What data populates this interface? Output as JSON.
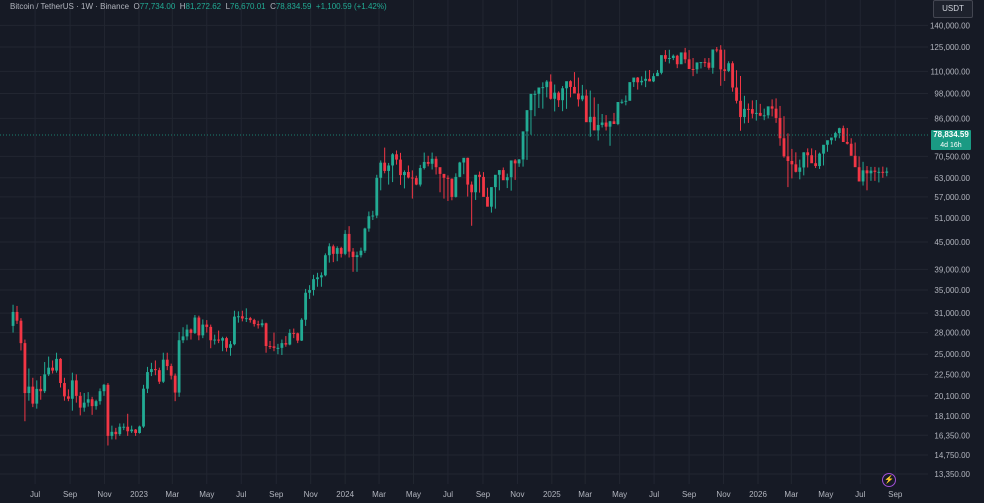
{
  "legend": {
    "symbol": "Bitcoin / TetherUS · 1W · Binance",
    "o_label": "O",
    "o_value": "77,734.00",
    "h_label": "H",
    "h_value": "81,272.62",
    "l_label": "L",
    "l_value": "76,670.01",
    "c_label": "C",
    "c_value": "78,834.59",
    "change": "+1,100.59 (+1.42%)"
  },
  "currency": "USDT",
  "last_price": {
    "price": "78,834.59",
    "countdown": "4d 16h"
  },
  "colors": {
    "up": "#22ab94",
    "down": "#f23645",
    "background": "#161a25",
    "grid": "#222631",
    "text": "#b2b5be"
  },
  "icons": [
    "lightning-icon"
  ],
  "chart_data": {
    "type": "candlestick",
    "scale": "log",
    "y_ticks": [
      140000,
      125000,
      110000,
      98000,
      86000,
      70500,
      63000,
      57000,
      51000,
      45000,
      39000,
      35000,
      31000,
      28000,
      25000,
      22500,
      20100,
      18100,
      16350,
      14750,
      13350
    ],
    "y_tick_labels": [
      "140,000.00",
      "125,000.00",
      "110,000.00",
      "98,000.00",
      "86,000.00",
      "70,500.00",
      "63,000.00",
      "57,000.00",
      "51,000.00",
      "45,000.00",
      "39,000.00",
      "35,000.00",
      "31,000.00",
      "28,000.00",
      "25,000.00",
      "22,500.00",
      "20,100.00",
      "18,100.00",
      "16,350.00",
      "14,750.00",
      "13,350.00"
    ],
    "x_ticks": [
      {
        "label": "Jul",
        "date": "2022-07-01"
      },
      {
        "label": "Sep",
        "date": "2022-09-01"
      },
      {
        "label": "Nov",
        "date": "2022-11-01"
      },
      {
        "label": "2023",
        "date": "2023-01-01"
      },
      {
        "label": "Mar",
        "date": "2023-03-01"
      },
      {
        "label": "May",
        "date": "2023-05-01"
      },
      {
        "label": "Jul",
        "date": "2023-07-01"
      },
      {
        "label": "Sep",
        "date": "2023-09-01"
      },
      {
        "label": "Nov",
        "date": "2023-11-01"
      },
      {
        "label": "2024",
        "date": "2024-01-01"
      },
      {
        "label": "Mar",
        "date": "2024-03-01"
      },
      {
        "label": "May",
        "date": "2024-05-01"
      },
      {
        "label": "Jul",
        "date": "2024-07-01"
      },
      {
        "label": "Sep",
        "date": "2024-09-01"
      },
      {
        "label": "Nov",
        "date": "2024-11-01"
      },
      {
        "label": "2025",
        "date": "2025-01-01"
      },
      {
        "label": "Mar",
        "date": "2025-03-01"
      },
      {
        "label": "May",
        "date": "2025-05-01"
      },
      {
        "label": "Jul",
        "date": "2025-07-01"
      },
      {
        "label": "Sep",
        "date": "2025-09-01"
      },
      {
        "label": "Nov",
        "date": "2025-11-01"
      },
      {
        "label": "2026",
        "date": "2026-01-01"
      },
      {
        "label": "Mar",
        "date": "2026-03-01"
      },
      {
        "label": "May",
        "date": "2026-05-01"
      },
      {
        "label": "Jul",
        "date": "2026-07-01"
      },
      {
        "label": "Sep",
        "date": "2026-09-01"
      }
    ],
    "candle_dates": [
      "2022-05-23",
      "2022-05-30",
      "2022-06-06",
      "2022-06-13",
      "2022-06-20",
      "2022-06-27",
      "2022-07-04",
      "2022-07-11",
      "2022-07-18",
      "2022-07-25",
      "2022-08-01",
      "2022-08-08",
      "2022-08-15",
      "2022-08-22",
      "2022-08-29",
      "2022-09-05",
      "2022-09-12",
      "2022-09-19",
      "2022-09-26",
      "2022-10-03",
      "2022-10-10",
      "2022-10-17",
      "2022-10-24",
      "2022-10-31",
      "2022-11-07",
      "2022-11-14",
      "2022-11-21",
      "2022-11-28",
      "2022-12-05",
      "2022-12-12",
      "2022-12-19",
      "2022-12-26",
      "2023-01-02",
      "2023-01-09",
      "2023-01-16",
      "2023-01-23",
      "2023-01-30",
      "2023-02-06",
      "2023-02-13",
      "2023-02-20",
      "2023-02-27",
      "2023-03-06",
      "2023-03-13",
      "2023-03-20",
      "2023-03-27",
      "2023-04-03",
      "2023-04-10",
      "2023-04-17",
      "2023-04-24",
      "2023-05-01",
      "2023-05-08",
      "2023-05-15",
      "2023-05-22",
      "2023-05-29",
      "2023-06-05",
      "2023-06-12",
      "2023-06-19",
      "2023-06-26",
      "2023-07-03",
      "2023-07-10",
      "2023-07-17",
      "2023-07-24",
      "2023-07-31",
      "2023-08-07",
      "2023-08-14",
      "2023-08-21",
      "2023-08-28",
      "2023-09-04",
      "2023-09-11",
      "2023-09-18",
      "2023-09-25",
      "2023-10-02",
      "2023-10-09",
      "2023-10-16",
      "2023-10-23",
      "2023-10-30",
      "2023-11-06",
      "2023-11-13",
      "2023-11-20",
      "2023-11-27",
      "2023-12-04",
      "2023-12-11",
      "2023-12-18",
      "2023-12-25",
      "2024-01-01",
      "2024-01-08",
      "2024-01-15",
      "2024-01-22",
      "2024-01-29",
      "2024-02-05",
      "2024-02-12",
      "2024-02-19",
      "2024-02-26",
      "2024-03-04",
      "2024-03-11",
      "2024-03-18",
      "2024-03-25",
      "2024-04-01",
      "2024-04-08",
      "2024-04-15",
      "2024-04-22",
      "2024-04-29",
      "2024-05-06",
      "2024-05-13",
      "2024-05-20",
      "2024-05-27",
      "2024-06-03",
      "2024-06-10",
      "2024-06-17",
      "2024-06-24",
      "2024-07-01",
      "2024-07-08",
      "2024-07-15",
      "2024-07-22",
      "2024-07-29",
      "2024-08-05",
      "2024-08-12",
      "2024-08-19",
      "2024-08-26",
      "2024-09-02",
      "2024-09-09",
      "2024-09-16",
      "2024-09-23",
      "2024-09-30",
      "2024-10-07",
      "2024-10-14",
      "2024-10-21",
      "2024-10-28",
      "2024-11-04",
      "2024-11-11",
      "2024-11-18",
      "2024-11-25",
      "2024-12-02",
      "2024-12-09",
      "2024-12-16",
      "2024-12-23",
      "2024-12-30",
      "2025-01-06",
      "2025-01-13",
      "2025-01-20",
      "2025-01-27",
      "2025-02-03",
      "2025-02-10",
      "2025-02-17",
      "2025-02-24",
      "2025-03-03",
      "2025-03-10",
      "2025-03-17",
      "2025-03-24",
      "2025-03-31",
      "2025-04-07",
      "2025-04-14",
      "2025-04-21",
      "2025-04-28",
      "2025-05-05",
      "2025-05-12",
      "2025-05-19",
      "2025-05-26",
      "2025-06-02",
      "2025-06-09",
      "2025-06-16",
      "2025-06-23",
      "2025-06-30",
      "2025-07-07",
      "2025-07-14",
      "2025-07-21",
      "2025-07-28",
      "2025-08-04",
      "2025-08-11",
      "2025-08-18",
      "2025-08-25",
      "2025-09-01",
      "2025-09-08",
      "2025-09-15",
      "2025-09-22",
      "2025-09-29",
      "2025-10-06",
      "2025-10-13",
      "2025-10-20",
      "2025-10-27",
      "2025-11-03",
      "2025-11-10",
      "2025-11-17",
      "2025-11-24",
      "2025-12-01",
      "2025-12-08",
      "2025-12-15",
      "2025-12-22",
      "2025-12-29",
      "2026-01-05",
      "2026-01-12",
      "2026-01-19",
      "2026-01-26",
      "2026-02-02",
      "2026-02-09",
      "2026-02-16",
      "2026-02-23",
      "2026-03-02",
      "2026-03-09",
      "2026-03-16",
      "2026-03-23",
      "2026-03-30",
      "2026-04-06",
      "2026-04-13",
      "2026-04-20",
      "2026-04-27",
      "2026-05-04",
      "2026-05-11",
      "2026-05-18",
      "2026-05-25",
      "2026-06-01",
      "2026-06-08",
      "2026-06-15",
      "2026-06-22",
      "2026-06-29",
      "2026-07-06",
      "2026-07-13",
      "2026-07-20",
      "2026-07-27",
      "2026-08-03",
      "2026-08-10",
      "2026-08-17"
    ],
    "open": [
      29000,
      31200,
      29800,
      26500,
      20400,
      21100,
      19300,
      20850,
      20600,
      22500,
      23300,
      22950,
      24400,
      21500,
      20050,
      19800,
      21800,
      20100,
      18900,
      19400,
      19750,
      19050,
      19550,
      20600,
      21300,
      16300,
      16650,
      16450,
      17100,
      17100,
      16700,
      16850,
      16550,
      17120,
      20870,
      22770,
      23130,
      23000,
      21650,
      24300,
      23500,
      22350,
      20450,
      26900,
      27450,
      28450,
      27950,
      30300,
      27600,
      29200,
      28850,
      26900,
      27000,
      26850,
      27200,
      25850,
      26350,
      30450,
      30500,
      30150,
      30200,
      29900,
      29280,
      29100,
      29400,
      26100,
      26050,
      25850,
      25850,
      26500,
      26300,
      27950,
      27900,
      26850,
      29950,
      34500,
      35000,
      37050,
      37400,
      37800,
      42000,
      44000,
      42300,
      43600,
      42300,
      46950,
      42800,
      41600,
      42000,
      43000,
      48300,
      51500,
      51700,
      63000,
      68200,
      65300,
      67200,
      71250,
      69300,
      63900,
      64950,
      63100,
      62900,
      60800,
      66300,
      68450,
      67800,
      69600,
      66600,
      64300,
      63000,
      62700,
      57000,
      63300,
      68250,
      69950,
      60800,
      58400,
      64000,
      63300,
      57000,
      54150,
      60000,
      64000,
      65600,
      62200,
      63200,
      69000,
      67950,
      69350,
      80350,
      89800,
      97800,
      97800,
      101100,
      101300,
      104300,
      95300,
      98400,
      94600,
      100700,
      104500,
      101400,
      98000,
      95000,
      96900,
      84300,
      86700,
      80750,
      83100,
      84150,
      82350,
      84700,
      83500,
      93700,
      93800,
      94300,
      104000,
      106500,
      103900,
      104700,
      105800,
      104400,
      107300,
      109200,
      119800,
      117500,
      118000,
      119400,
      114200,
      121500,
      117200,
      111400,
      111200,
      115300,
      115500,
      115200,
      112100,
      123400,
      123250,
      111200,
      110300,
      114800,
      101100,
      94300,
      86600,
      90400,
      90300,
      88150,
      88500,
      87200,
      87400,
      91600,
      90500,
      86200,
      77500,
      70500,
      68800,
      67600,
      65000,
      66500,
      72000,
      70900,
      68000,
      67000,
      71500,
      74900,
      76700,
      77800,
      79600,
      81700,
      76000,
      75300,
      70700,
      66600,
      61800,
      65500,
      64500,
      65400,
      65000,
      65000,
      64700,
      65100,
      77734
    ],
    "close": [
      31200,
      29800,
      26500,
      20400,
      21100,
      19300,
      20850,
      20600,
      22500,
      23300,
      22950,
      24400,
      21500,
      20050,
      19800,
      21800,
      20100,
      18900,
      19400,
      19750,
      19050,
      19550,
      20600,
      21300,
      16300,
      16650,
      16450,
      17100,
      17100,
      16700,
      16850,
      16550,
      17120,
      20870,
      22770,
      23130,
      23000,
      21650,
      24300,
      23500,
      22350,
      20450,
      26900,
      27450,
      28450,
      27950,
      30300,
      27600,
      29200,
      28850,
      26900,
      27000,
      26850,
      27200,
      25850,
      26350,
      30450,
      30500,
      30150,
      30200,
      29900,
      29280,
      29100,
      29400,
      26100,
      26050,
      25850,
      25850,
      26500,
      26300,
      27950,
      27900,
      26850,
      29950,
      34500,
      35000,
      37050,
      37400,
      37800,
      42000,
      44000,
      42300,
      43600,
      42300,
      46950,
      42800,
      41600,
      42000,
      43000,
      48300,
      51500,
      51700,
      63000,
      68200,
      65300,
      67200,
      71250,
      69300,
      63900,
      64950,
      63100,
      62900,
      60800,
      66300,
      68450,
      67800,
      69600,
      66600,
      64300,
      63000,
      62700,
      57000,
      63300,
      68250,
      69950,
      60800,
      58400,
      64000,
      63300,
      57000,
      54150,
      60000,
      64000,
      65600,
      62200,
      63200,
      69000,
      67950,
      69350,
      80350,
      89800,
      97800,
      97800,
      101100,
      101300,
      104300,
      95300,
      98400,
      94600,
      100700,
      104500,
      101400,
      98000,
      95000,
      96900,
      84300,
      86700,
      80750,
      83100,
      84150,
      82350,
      84700,
      83500,
      93700,
      93800,
      94300,
      104000,
      106500,
      103900,
      104700,
      105800,
      104400,
      107300,
      109200,
      119800,
      117500,
      118000,
      119400,
      114200,
      121500,
      117200,
      111400,
      111200,
      115300,
      115500,
      115200,
      112100,
      123400,
      123250,
      111200,
      110300,
      114800,
      101100,
      94300,
      86600,
      90400,
      90300,
      88150,
      88500,
      87200,
      87400,
      91600,
      90500,
      86200,
      77500,
      70500,
      68800,
      67600,
      65000,
      66500,
      72000,
      70900,
      68000,
      67000,
      71500,
      74900,
      76700,
      77800,
      79600,
      81700,
      76000,
      75300,
      70700,
      66600,
      61800,
      65500,
      64500,
      65400,
      65000,
      65000,
      64700,
      65100,
      77734,
      78835
    ],
    "high": [
      32400,
      32200,
      30200,
      27000,
      23200,
      22100,
      21800,
      22300,
      24000,
      24700,
      24200,
      25200,
      24500,
      22100,
      20800,
      22700,
      22500,
      20500,
      20400,
      20500,
      20000,
      19700,
      20900,
      21400,
      21500,
      17200,
      17000,
      17400,
      17400,
      18300,
      17200,
      16900,
      17200,
      21300,
      23400,
      23900,
      24200,
      23300,
      25200,
      25200,
      23800,
      22600,
      28100,
      28800,
      29200,
      28600,
      30700,
      30600,
      30000,
      29900,
      29200,
      27700,
      28300,
      27400,
      27400,
      26800,
      31400,
      31300,
      31400,
      31800,
      30400,
      30100,
      29800,
      30000,
      29500,
      26800,
      28000,
      26400,
      27000,
      27500,
      28500,
      28600,
      28000,
      30200,
      35200,
      35900,
      37900,
      38300,
      38400,
      42400,
      44700,
      44400,
      44000,
      43900,
      47900,
      48900,
      43600,
      42800,
      43700,
      48500,
      52800,
      53000,
      64000,
      69000,
      73800,
      68100,
      71700,
      72700,
      71800,
      65500,
      67200,
      65500,
      63700,
      67400,
      71900,
      70700,
      71900,
      70500,
      66500,
      64300,
      63800,
      62800,
      64500,
      68500,
      69900,
      70000,
      61800,
      62500,
      65100,
      64900,
      59800,
      59300,
      60700,
      64800,
      66500,
      64400,
      64000,
      69500,
      69500,
      70200,
      81800,
      93400,
      99500,
      99800,
      103900,
      105100,
      108300,
      102700,
      99100,
      101900,
      102800,
      105000,
      109600,
      106500,
      102500,
      100000,
      99500,
      96000,
      92800,
      88000,
      87500,
      84900,
      88500,
      88700,
      95000,
      97000,
      97900,
      104600,
      106800,
      107200,
      110400,
      110800,
      108900,
      110800,
      112000,
      123000,
      123200,
      120200,
      120000,
      119500,
      124400,
      123000,
      118000,
      113500,
      115500,
      117900,
      118000,
      116300,
      125000,
      126200,
      123300,
      116000,
      116000,
      110700,
      107400,
      96800,
      93000,
      94500,
      94700,
      92800,
      90500,
      90500,
      95000,
      95500,
      91800,
      87000,
      79500,
      73300,
      72000,
      69300,
      72000,
      73500,
      73500,
      72800,
      71900,
      74500,
      75700,
      77200,
      80200,
      81900,
      82800,
      81800,
      77500,
      75800,
      70500,
      68500,
      67000,
      66700,
      66700,
      66500,
      66800,
      66500,
      66000,
      78800,
      81272.62
    ],
    "low": [
      28000,
      29300,
      25500,
      17600,
      19600,
      18950,
      18800,
      19700,
      20400,
      22300,
      22600,
      22700,
      21000,
      19600,
      19550,
      18600,
      19400,
      18150,
      18500,
      19000,
      18200,
      18700,
      19200,
      20100,
      15500,
      16000,
      16000,
      16300,
      16800,
      16300,
      16550,
      16300,
      16500,
      17000,
      20400,
      22300,
      22400,
      21400,
      21500,
      23000,
      21900,
      19550,
      20000,
      26500,
      26900,
      27000,
      27800,
      26900,
      27200,
      28000,
      25800,
      26300,
      26500,
      25400,
      25350,
      24800,
      26200,
      29500,
      29700,
      29600,
      29500,
      28900,
      28600,
      28800,
      25200,
      25700,
      25400,
      25000,
      24900,
      26000,
      26200,
      27200,
      26500,
      26800,
      29000,
      33400,
      34000,
      35600,
      35600,
      37600,
      40400,
      40500,
      40700,
      41500,
      42000,
      41500,
      38500,
      38500,
      41500,
      42500,
      47500,
      50500,
      51000,
      59000,
      64500,
      60800,
      61600,
      67500,
      60700,
      59600,
      62800,
      56500,
      60600,
      60200,
      65800,
      66900,
      65800,
      64100,
      58400,
      56500,
      55800,
      56000,
      56800,
      63200,
      64200,
      57100,
      49000,
      56100,
      58300,
      62700,
      55700,
      52500,
      53600,
      59000,
      62600,
      59700,
      58900,
      62300,
      66700,
      66800,
      69200,
      79000,
      87000,
      90800,
      90500,
      96000,
      94900,
      89200,
      91300,
      89300,
      90400,
      96000,
      99800,
      91500,
      94100,
      93300,
      78100,
      82200,
      76600,
      82000,
      80700,
      74500,
      83900,
      83000,
      92800,
      92100,
      98000,
      101400,
      100000,
      102300,
      101300,
      105000,
      104000,
      107400,
      108300,
      115700,
      114700,
      116700,
      111900,
      117200,
      114800,
      115000,
      107300,
      108700,
      111700,
      112600,
      111000,
      108700,
      121600,
      102000,
      104600,
      109600,
      98900,
      93000,
      80600,
      83800,
      84000,
      86000,
      85000,
      87000,
      85200,
      86000,
      86900,
      84000,
      74500,
      70000,
      60000,
      62800,
      64800,
      62500,
      63800,
      66500,
      68500,
      66300,
      66000,
      67200,
      72200,
      75000,
      76500,
      77500,
      78800,
      75000,
      72000,
      68500,
      66000,
      60500,
      59000,
      62000,
      62000,
      61500,
      63000,
      63500,
      62500,
      64300,
      76670.01
    ]
  }
}
